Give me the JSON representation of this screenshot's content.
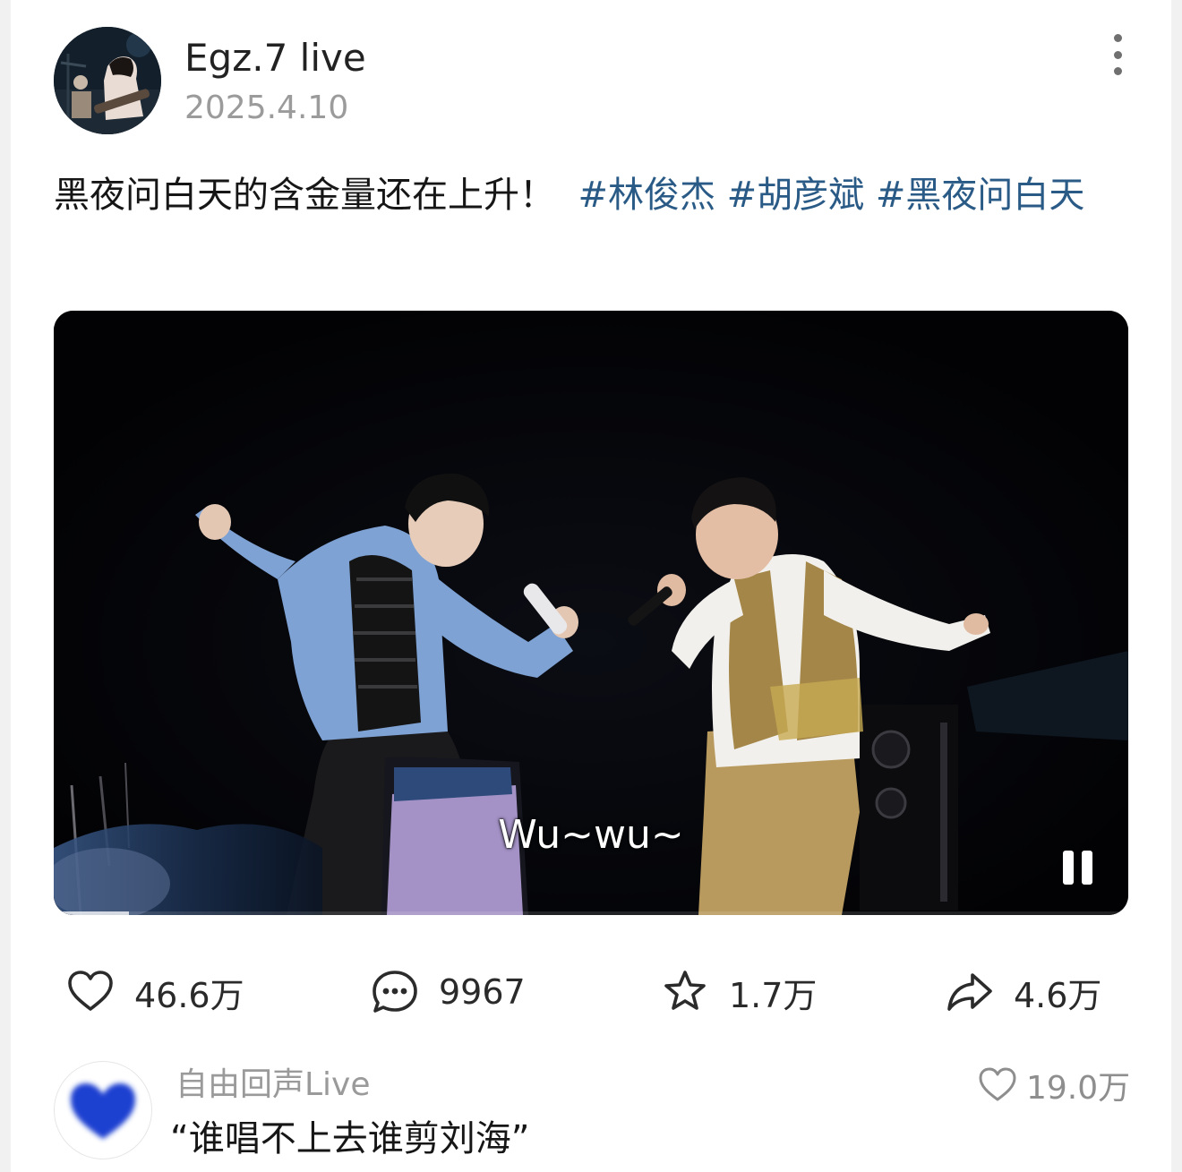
{
  "post": {
    "username": "Egz.7 live",
    "date": "2025.4.10",
    "caption_text": "黑夜问白天的含金量还在上升！",
    "hashtags": [
      "#林俊杰",
      "#胡彦斌",
      "#黑夜问白天"
    ]
  },
  "video": {
    "subtitle": "Wu~wu~",
    "state": "playing",
    "progress": 0.07
  },
  "actions": {
    "like_count": "46.6万",
    "comment_count": "9967",
    "favorite_count": "1.7万",
    "share_count": "4.6万"
  },
  "top_comment": {
    "author": "自由回声Live",
    "text": "“谁唱不上去谁剪刘海”",
    "like_count": "19.0万"
  },
  "icons": {
    "more": "more-vertical-icon",
    "like": "heart-icon",
    "comment": "comment-bubble-icon",
    "favorite": "star-icon",
    "share": "share-arrow-icon",
    "pause": "pause-icon"
  },
  "colors": {
    "hashtag": "#2a5a86",
    "secondary_text": "#9b9b9b",
    "comment_avatar": "#1f3fd0"
  }
}
